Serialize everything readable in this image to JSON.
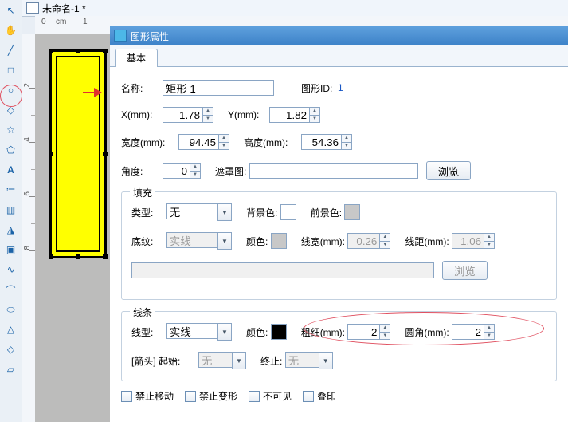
{
  "title": "未命名-1 *",
  "ruler_top": {
    "zero": "0",
    "unit": "cm",
    "one": "1"
  },
  "ruler_left": [
    "2",
    "4",
    "6",
    "8"
  ],
  "panel_title": "图形属性",
  "tab_basic": "基本",
  "labels": {
    "name": "名称:",
    "shape_id": "图形ID:",
    "x": "X(mm):",
    "y": "Y(mm):",
    "width": "宽度(mm):",
    "height": "高度(mm):",
    "angle": "角度:",
    "mask": "遮罩图:",
    "browse": "浏览",
    "fill": "填充",
    "type": "类型:",
    "bg": "背景色:",
    "fg": "前景色:",
    "pattern": "底纹:",
    "color": "颜色:",
    "line_w": "线宽(mm):",
    "line_gap": "线距(mm):",
    "stroke": "线条",
    "line_style": "线型:",
    "thick": "粗细(mm):",
    "radius": "圆角(mm):",
    "arrow": "[箭头] 起始:",
    "end": "终止:",
    "lock_move": "禁止移动",
    "lock_transform": "禁止变形",
    "invisible": "不可见",
    "overprint": "叠印"
  },
  "values": {
    "name": "矩形 1",
    "id": "1",
    "x": "1.78",
    "y": "1.82",
    "width": "94.45",
    "height": "54.36",
    "angle": "0",
    "fill_type": "无",
    "pattern": "实线",
    "line_w": "0.26",
    "line_gap": "1.06",
    "line_style": "实线",
    "thick": "2",
    "radius": "2",
    "arrow_start": "无",
    "arrow_end": "无"
  },
  "icons": [
    "↖",
    "✋",
    "╱",
    "□",
    "○",
    "◇",
    "☆",
    "⬠",
    "A",
    "≔",
    "▥",
    "◮",
    "▣",
    "∿",
    "⌒",
    "⬭",
    "△",
    "◇",
    "▱"
  ]
}
